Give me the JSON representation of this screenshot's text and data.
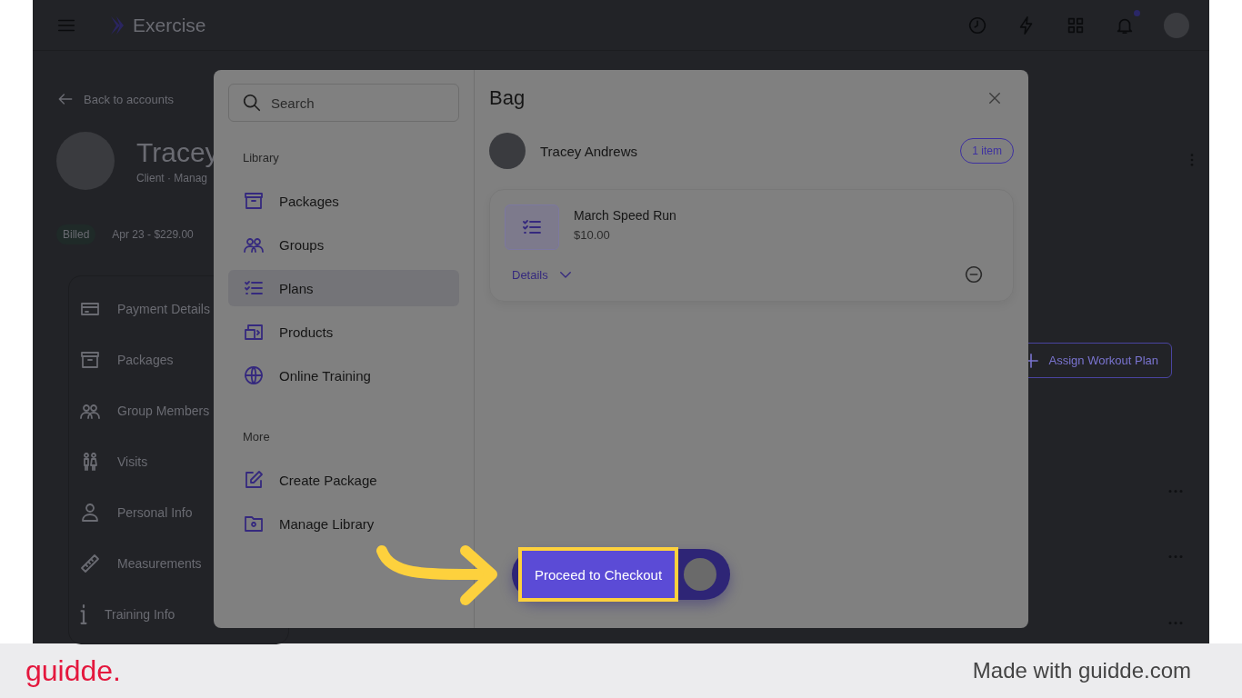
{
  "app_header": {
    "title": "Exercise",
    "notification_dot": true
  },
  "back_link": "Back to accounts",
  "client": {
    "name": "Tracey",
    "subtitle": "Client · Manag",
    "status_badge": "Billed",
    "billing": "Apr 23 - $229.00"
  },
  "client_menu": [
    {
      "label": "Payment Details",
      "kind": "card"
    },
    {
      "label": "Packages",
      "kind": "package"
    },
    {
      "label": "Group Members",
      "kind": "group"
    },
    {
      "label": "Visits",
      "kind": "visits"
    },
    {
      "label": "Personal Info",
      "kind": "person"
    },
    {
      "label": "Measurements",
      "kind": "ruler"
    },
    {
      "label": "Training Info",
      "kind": "info"
    }
  ],
  "assign_button": "Assign Workout Plan",
  "library_panel": {
    "search": {
      "placeholder": "Search"
    },
    "sections": [
      {
        "title": "Library",
        "items": [
          {
            "label": "Packages",
            "kind": "package",
            "selected": false
          },
          {
            "label": "Groups",
            "kind": "group",
            "selected": false
          },
          {
            "label": "Plans",
            "kind": "plans",
            "selected": true
          },
          {
            "label": "Products",
            "kind": "products",
            "selected": false
          },
          {
            "label": "Online Training",
            "kind": "globe",
            "selected": false
          }
        ]
      },
      {
        "title": "More",
        "items": [
          {
            "label": "Create Package",
            "kind": "edit",
            "selected": false
          },
          {
            "label": "Manage Library",
            "kind": "folder",
            "selected": false
          }
        ]
      }
    ]
  },
  "bag": {
    "title": "Bag",
    "customer": "Tracey Andrews",
    "item_count": "1 item",
    "items": [
      {
        "name": "March Speed Run",
        "price": "$10.00",
        "details_label": "Details",
        "expanded": false
      }
    ]
  },
  "checkout_button": "Proceed to Checkout",
  "footer": {
    "brand": "guidde.",
    "credit": "Made with guidde.com"
  }
}
